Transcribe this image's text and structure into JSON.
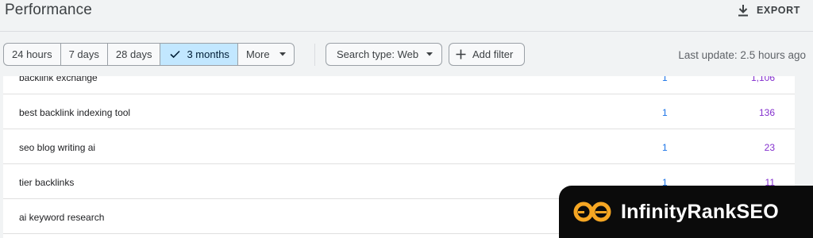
{
  "header": {
    "title": "Performance",
    "export_label": "EXPORT"
  },
  "filters": {
    "ranges": [
      {
        "label": "24 hours",
        "selected": false
      },
      {
        "label": "7 days",
        "selected": false
      },
      {
        "label": "28 days",
        "selected": false
      },
      {
        "label": "3 months",
        "selected": true
      },
      {
        "label": "More",
        "selected": false
      }
    ],
    "search_type_label": "Search type: Web",
    "add_filter_label": "Add filter",
    "last_update": "Last update: 2.5 hours ago"
  },
  "table": {
    "rows": [
      {
        "query": "backlink exchange",
        "clicks": "1",
        "impressions": "1,106"
      },
      {
        "query": "best backlink indexing tool",
        "clicks": "1",
        "impressions": "136"
      },
      {
        "query": "seo blog writing ai",
        "clicks": "1",
        "impressions": "23"
      },
      {
        "query": "tier backlinks",
        "clicks": "1",
        "impressions": "11"
      },
      {
        "query": "ai keyword research",
        "clicks": "",
        "impressions": ""
      }
    ]
  },
  "watermark": {
    "text": "InfinityRankSEO",
    "colors": {
      "background": "#0b0b0b",
      "ring": "#f5a623",
      "text": "#ffffff"
    }
  },
  "colors": {
    "selected_chip": "#c2e7ff",
    "clicks": "#1a73e8",
    "impressions": "#8430ce"
  }
}
